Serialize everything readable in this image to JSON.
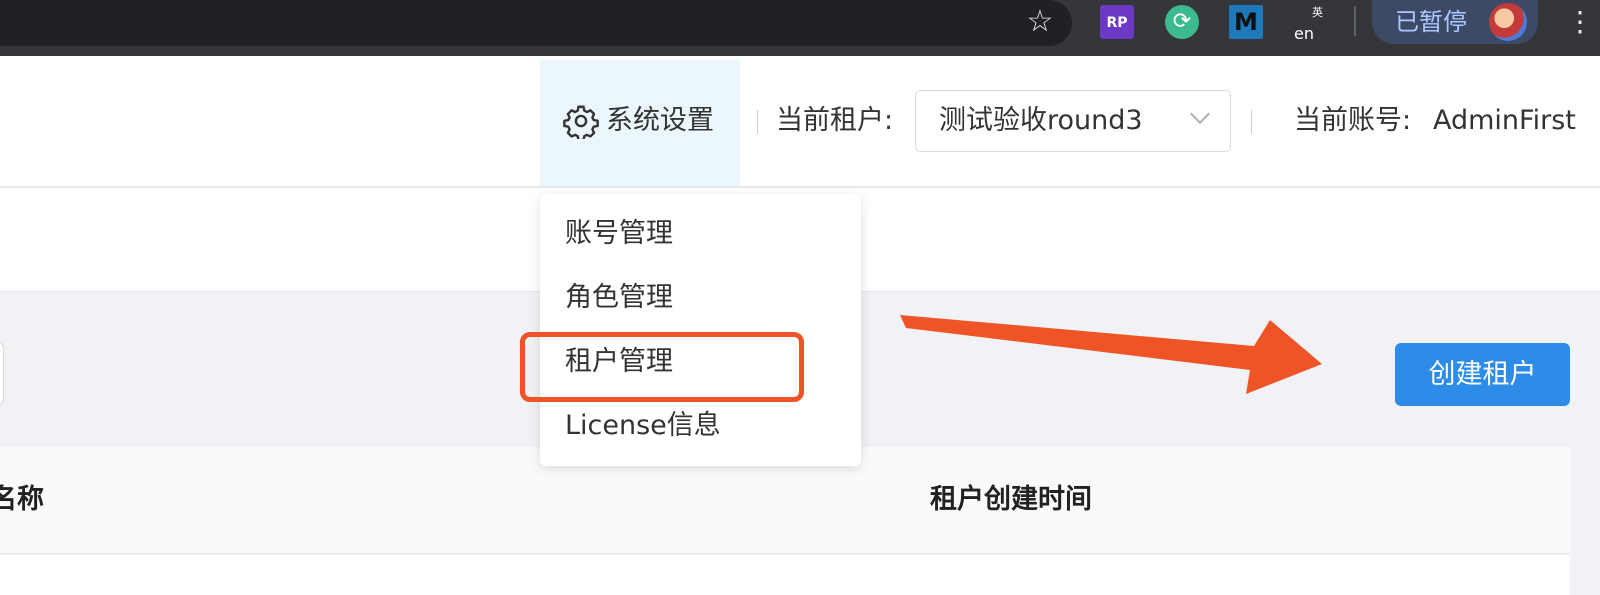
{
  "browser": {
    "paused_label": "已暂停",
    "extensions": [
      {
        "icon": "axure-rp-icon",
        "label": "RP"
      },
      {
        "icon": "sync-icon",
        "label": "⟳"
      },
      {
        "icon": "m-extension-icon",
        "label": "M"
      },
      {
        "icon": "translate-en-icon",
        "label": "en",
        "sub_label": "英"
      }
    ]
  },
  "header": {
    "system_settings_label": "系统设置",
    "current_tenant_label": "当前租户:",
    "tenant_select_value": "测试验收round3",
    "current_account_label": "当前账号:",
    "current_account_value": "AdminFirst"
  },
  "dropdown": {
    "items": [
      "账号管理",
      "角色管理",
      "租户管理",
      "License信息"
    ],
    "highlighted_index": 2,
    "highlight_color": "#ef5427"
  },
  "actions": {
    "create_tenant_label": "创建租户",
    "primary_color": "#2d8ce8"
  },
  "table": {
    "columns": [
      "名称",
      "租户创建时间"
    ]
  }
}
